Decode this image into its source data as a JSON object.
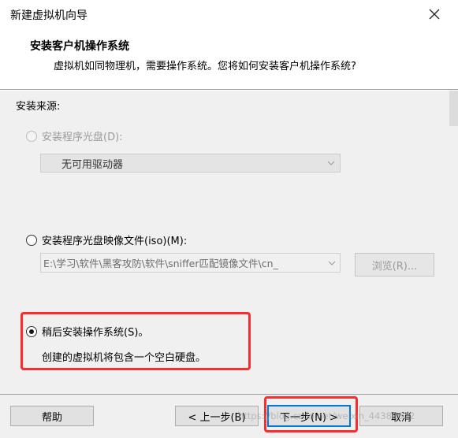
{
  "window": {
    "title": "新建虚拟机向导",
    "close_icon": "close-icon"
  },
  "header": {
    "title": "安装客户机操作系统",
    "subtitle": "虚拟机如同物理机，需要操作系统。您将如何安装客户机操作系统?"
  },
  "install_source": {
    "label": "安装来源:",
    "disc_option": {
      "label": "安装程序光盘(D):",
      "selected": false,
      "disabled": true,
      "dropdown_value": "无可用驱动器"
    },
    "iso_option": {
      "label": "安装程序光盘映像文件(iso)(M):",
      "selected": false,
      "path_value": "E:\\学习\\软件\\黑客攻防\\软件\\sniffer匹配镜像文件\\cn_",
      "browse_label": "浏览(R)..."
    },
    "later_option": {
      "label": "稍后安装操作系统(S)。",
      "selected": true,
      "description": "创建的虚拟机将包含一个空白硬盘。"
    }
  },
  "footer": {
    "help_label": "帮助",
    "back_label": "< 上一步(B)",
    "next_label": "下一步(N) >",
    "cancel_label": "取消"
  },
  "watermark": "https://blog.csdn.net/weixin_44380622",
  "colors": {
    "highlight": "#ff2a2a",
    "default_button_border": "#0078d7",
    "panel_bg": "#f0f0f0"
  }
}
